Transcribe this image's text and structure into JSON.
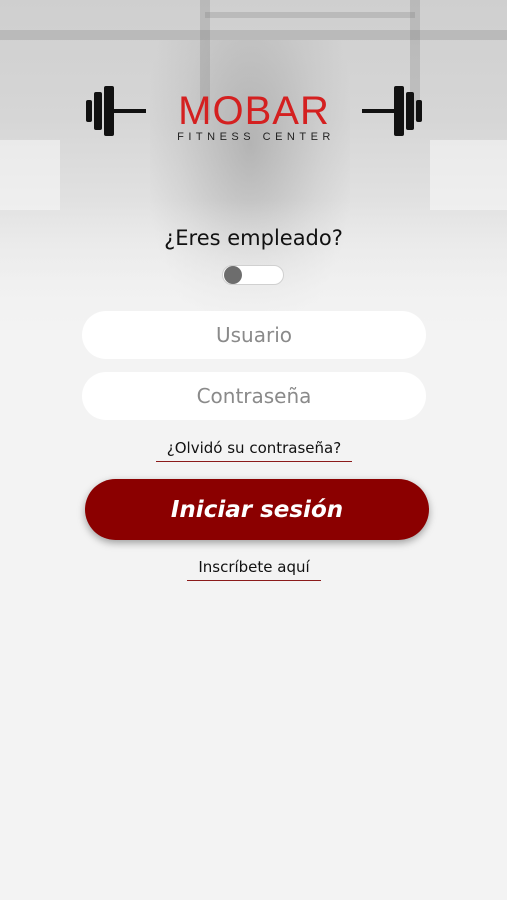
{
  "brand": {
    "name": "MOBAR",
    "tagline": "FITNESS CENTER",
    "accent": "#d42020"
  },
  "employee": {
    "question": "¿Eres empleado?",
    "toggle_on": false
  },
  "form": {
    "username_placeholder": "Usuario",
    "username_value": "",
    "password_placeholder": "Contraseña",
    "password_value": ""
  },
  "links": {
    "forgot_password": "¿Olvidó su contraseña?",
    "signup": "Inscríbete aquí"
  },
  "login_button": {
    "label": "Iniciar sesión",
    "color": "#8b0000"
  }
}
